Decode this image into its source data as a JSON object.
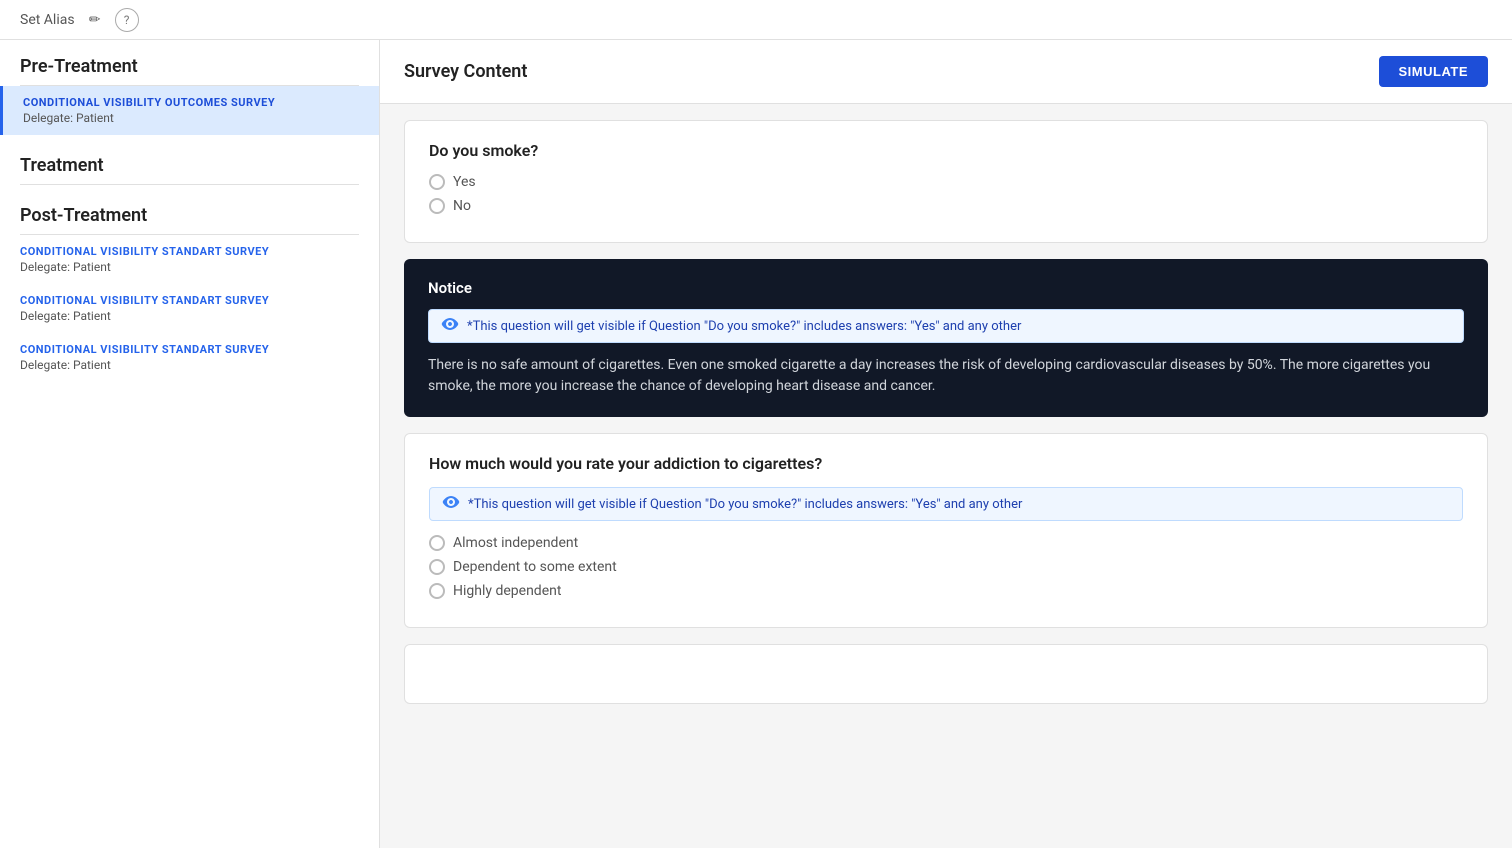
{
  "topbar": {
    "title": "Set Alias",
    "edit_icon": "✏",
    "help_icon": "?"
  },
  "sidebar": {
    "sections": [
      {
        "id": "pre-treatment",
        "label": "Pre-Treatment",
        "items": [
          {
            "id": "pre-1",
            "name": "CONDITIONAL VISIBILITY OUTCOMES SURVEY",
            "delegate": "Delegate: Patient",
            "active": true
          }
        ]
      },
      {
        "id": "treatment",
        "label": "Treatment",
        "items": []
      },
      {
        "id": "post-treatment",
        "label": "Post-Treatment",
        "items": [
          {
            "id": "post-1",
            "name": "CONDITIONAL VISIBILITY STANDART SURVEY",
            "delegate": "Delegate: Patient",
            "active": false
          },
          {
            "id": "post-2",
            "name": "CONDITIONAL VISIBILITY STANDART SURVEY",
            "delegate": "Delegate: Patient",
            "active": false
          },
          {
            "id": "post-3",
            "name": "CONDITIONAL VISIBILITY STANDART SURVEY",
            "delegate": "Delegate: Patient",
            "active": false
          }
        ]
      }
    ]
  },
  "content": {
    "header": {
      "title": "Survey Content",
      "simulate_button": "SIMULATE"
    },
    "question1": {
      "text": "Do you smoke?",
      "options": [
        {
          "label": "Yes"
        },
        {
          "label": "No"
        }
      ]
    },
    "notice": {
      "title": "Notice",
      "visibility_text": "*This question will get visible if Question \"Do you smoke?\" includes answers: \"Yes\" and any other",
      "body_text": "There is no safe amount of cigarettes. Even one smoked cigarette a day increases the risk of developing cardiovascular diseases by 50%. The more cigarettes you smoke, the more you increase the chance of developing heart disease and cancer."
    },
    "question2": {
      "text": "How much would you rate your addiction to cigarettes?",
      "visibility_text": "*This question will get visible if Question \"Do you smoke?\" includes answers: \"Yes\" and any other",
      "options": [
        {
          "label": "Almost independent"
        },
        {
          "label": "Dependent to some extent"
        },
        {
          "label": "Highly dependent"
        }
      ]
    }
  }
}
